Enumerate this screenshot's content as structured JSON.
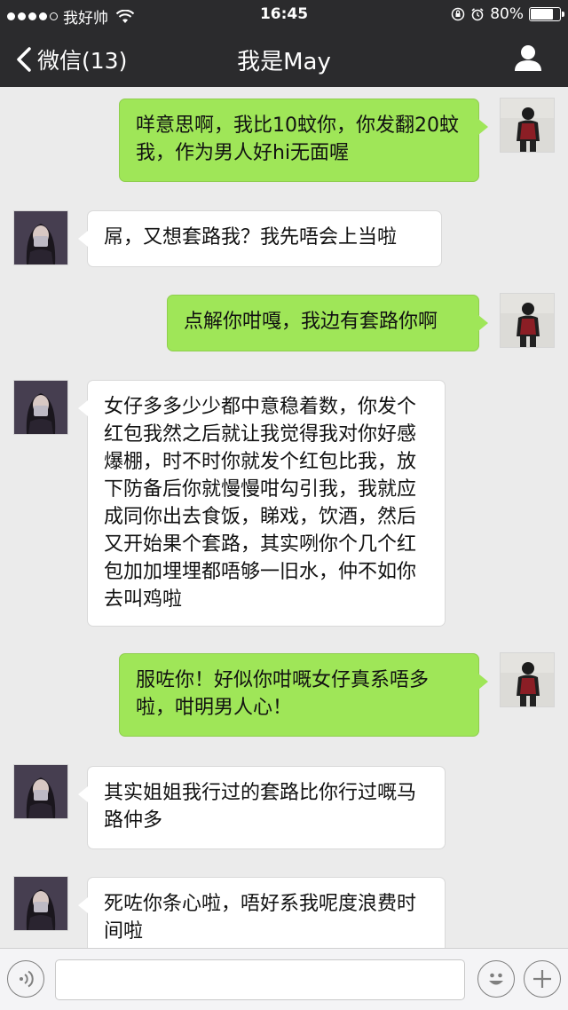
{
  "status_bar": {
    "carrier": "我好帅",
    "time": "16:45",
    "battery": "80%",
    "battery_level": 0.8,
    "signal_bars_filled": 4,
    "signal_bars_total": 5,
    "icons": [
      "wifi-icon",
      "orientation-lock-icon",
      "alarm-icon",
      "battery-icon"
    ]
  },
  "nav": {
    "back_label": "微信(13)",
    "title": "我是May",
    "icons": [
      "chevron-left-icon",
      "profile-icon"
    ]
  },
  "messages": [
    {
      "sender": "me",
      "text": "咩意思啊，我比10蚊你，你发翻20蚊我，作为男人好hi无面喔"
    },
    {
      "sender": "her",
      "text": "屌，又想套路我？我先唔会上当啦"
    },
    {
      "sender": "me",
      "text": "点解你咁嘎，我边有套路你啊"
    },
    {
      "sender": "her",
      "text": "女仔多多少少都中意稳着数，你发个红包我然之后就让我觉得我对你好感爆棚，时不时你就发个红包比我，放下防备后你就慢慢咁勾引我，我就应成同你出去食饭，睇戏，饮酒，然后又开始果个套路，其实咧你个几个红包加加埋埋都唔够一旧水，仲不如你去叫鸡啦"
    },
    {
      "sender": "me",
      "text": "服咗你！好似你咁嘅女仔真系唔多啦，咁明男人心！"
    },
    {
      "sender": "her",
      "text": "其实姐姐我行过的套路比你行过嘅马路仲多"
    },
    {
      "sender": "her",
      "text": "死咗你条心啦，唔好系我呢度浪费时间啦"
    }
  ],
  "input_bar": {
    "text_value": "",
    "icons": [
      "voice-icon",
      "emoji-icon",
      "plus-icon"
    ]
  },
  "colors": {
    "bar_background": "#2b2b2d",
    "chat_background": "#ebebeb",
    "my_bubble": "#9fe658",
    "her_bubble": "#ffffff"
  }
}
